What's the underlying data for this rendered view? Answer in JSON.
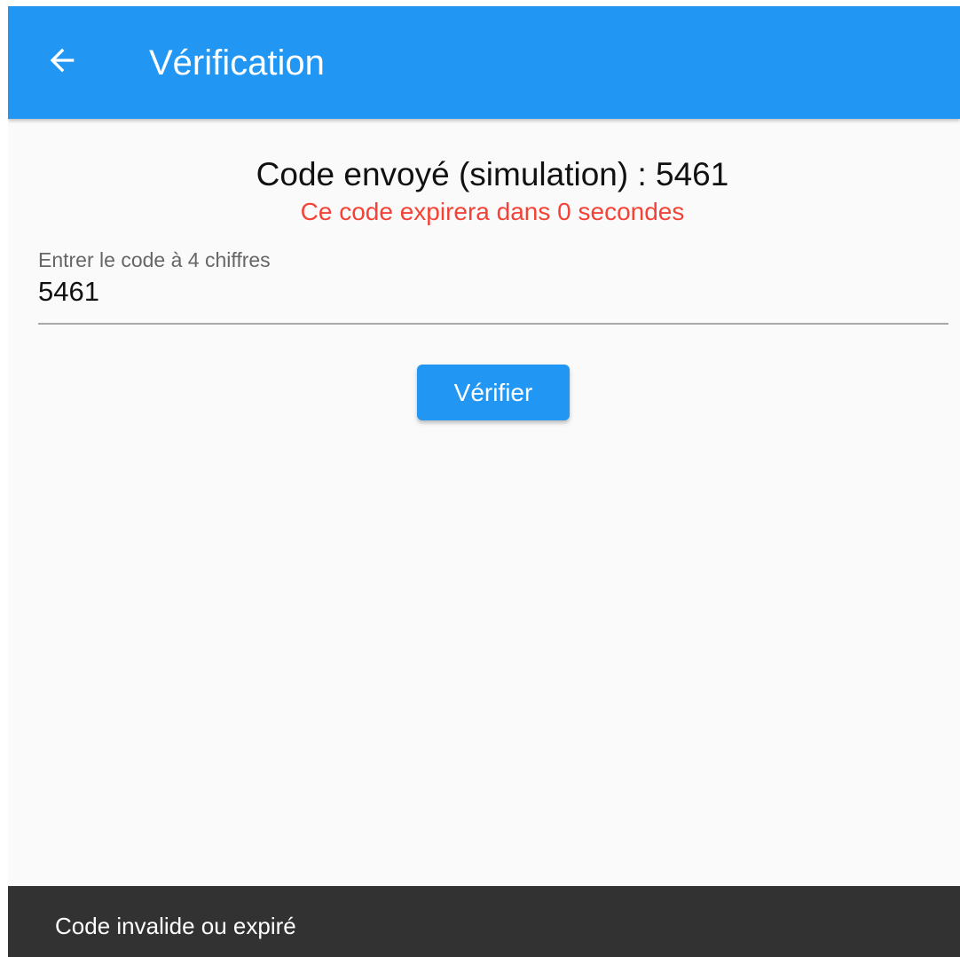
{
  "app_bar": {
    "title": "Vérification",
    "back_icon": "arrow-back-icon",
    "color": "#2196f3"
  },
  "main": {
    "code_heading": "Code envoyé (simulation) : 5461",
    "expire_message": "Ce code expirera dans 0 secondes",
    "expire_color": "#f44336",
    "code_field": {
      "label": "Entrer le code à 4 chiffres",
      "value": "5461"
    },
    "verify_button_label": "Vérifier"
  },
  "snackbar": {
    "message": "Code invalide ou expiré"
  }
}
